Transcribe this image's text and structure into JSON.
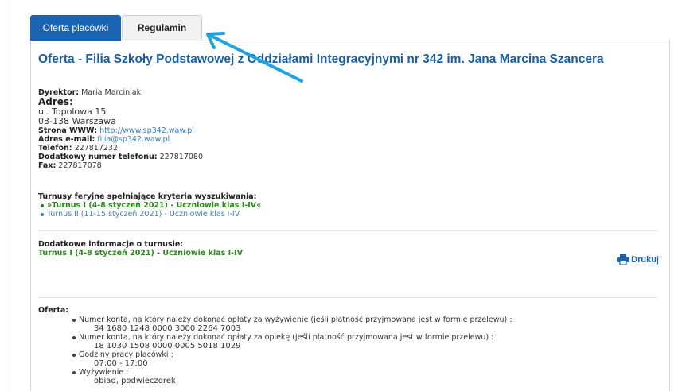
{
  "tabs": [
    {
      "label": "Oferta placówki"
    },
    {
      "label": "Regulamin"
    }
  ],
  "title": "Oferta - Filia Szkoły Podstawowej z Oddziałami Integracyjnymi nr 342 im. Jana Marcina Szancera",
  "info": {
    "dyrektor_label": "Dyrektor:",
    "dyrektor_value": "Maria Marciniak",
    "adres_label": "Adres:",
    "adres_line1": "ul. Topolowa 15",
    "adres_line2": "03-138 Warszawa",
    "www_label": "Strona WWW:",
    "www_value": "http://www.sp342.waw.pl",
    "email_label": "Adres e-mail:",
    "email_value": "filia@sp342.waw.pl",
    "telefon_label": "Telefon:",
    "telefon_value": "227817232",
    "dod_tel_label": "Dodatkowy numer telefonu:",
    "dod_tel_value": "227817080",
    "fax_label": "Fax:",
    "fax_value": "227817078"
  },
  "turnusy": {
    "heading": "Turnusy feryjne spełniające kryteria wyszukiwania:",
    "items": [
      "»Turnus I (4-8 styczeń 2021) - Uczniowie klas I-IV«",
      "Turnus II (11-15 styczeń 2021) - Uczniowie klas I-IV"
    ]
  },
  "dodatkowe": {
    "heading": "Dodatkowe informacje o turnusie:",
    "turnus": "Turnus I (4-8 styczeń 2021) - Uczniowie klas I-IV"
  },
  "print_label": "Drukuj",
  "oferta": {
    "heading": "Oferta:",
    "items": [
      {
        "label": "Numer konta, na który należy dokonać opłaty za wyżywienie (jeśli płatność przyjmowana jest w formie przelewu) :",
        "value": "34 1680 1248 0000 3000 2264 7003"
      },
      {
        "label": "Numer konta, na który należy dokonać opłaty za opiekę (jeśli płatność przyjmowana jest w formie przelewu) :",
        "value": "18 1030 1508 0000 0005 5018 1029"
      },
      {
        "label": "Godziny pracy placówki :",
        "value": "07:00 - 17:00"
      },
      {
        "label": "Wyżywienie :",
        "value": "obiad, podwieczorek"
      }
    ]
  },
  "colors": {
    "accent": "#1a63b0",
    "title": "#1a5fa3",
    "green": "#2a8a1a",
    "link": "#3a7fc1",
    "arrow": "#1fa3e0"
  }
}
